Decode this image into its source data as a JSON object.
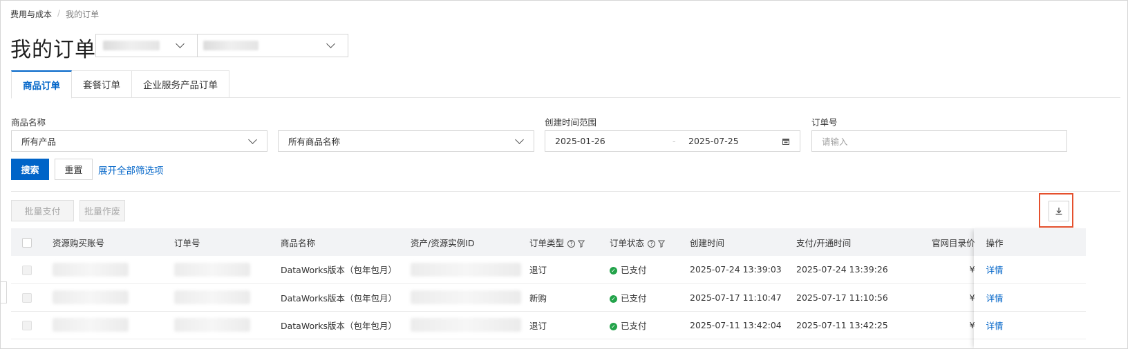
{
  "breadcrumb": {
    "parent": "费用与成本",
    "separator": "/",
    "current": "我的订单"
  },
  "page_title": "我的订单",
  "tabs": [
    {
      "label": "商品订单",
      "active": true
    },
    {
      "label": "套餐订单",
      "active": false
    },
    {
      "label": "企业服务产品订单",
      "active": false
    }
  ],
  "filters": {
    "product_name_label": "商品名称",
    "product_select": "所有产品",
    "product_name_select": "所有商品名称",
    "time_range_label": "创建时间范围",
    "date_start": "2025-01-26",
    "date_end": "2025-07-25",
    "order_no_label": "订单号",
    "order_no_placeholder": "请输入"
  },
  "actions": {
    "search": "搜索",
    "reset": "重置",
    "expand_filters": "展开全部筛选项",
    "batch_pay": "批量支付",
    "batch_void": "批量作废"
  },
  "table": {
    "headers": [
      "资源购买账号",
      "订单号",
      "商品名称",
      "资产/资源实例ID",
      "订单类型",
      "订单状态",
      "创建时间",
      "支付/开通时间",
      "官网目录价",
      "操作"
    ],
    "rows": [
      {
        "product": "DataWorks版本（包年包月）",
        "type": "退订",
        "status": "已支付",
        "created": "2025-07-24 13:39:03",
        "paid": "2025-07-24 13:39:26",
        "price": "¥",
        "action": "详情"
      },
      {
        "product": "DataWorks版本（包年包月）",
        "type": "新购",
        "status": "已支付",
        "created": "2025-07-17 11:10:47",
        "paid": "2025-07-17 11:10:56",
        "price": "¥",
        "action": "详情"
      },
      {
        "product": "DataWorks版本（包年包月）",
        "type": "退订",
        "status": "已支付",
        "created": "2025-07-11 13:42:04",
        "paid": "2025-07-11 13:42:25",
        "price": "¥",
        "action": "详情"
      }
    ]
  },
  "colors": {
    "primary": "#0064c8",
    "highlight": "#e5502d",
    "success": "#23a34a"
  },
  "icons": [
    "chevron-down-icon",
    "calendar-icon",
    "download-icon",
    "question-icon",
    "filter-icon",
    "check-circle-icon"
  ]
}
